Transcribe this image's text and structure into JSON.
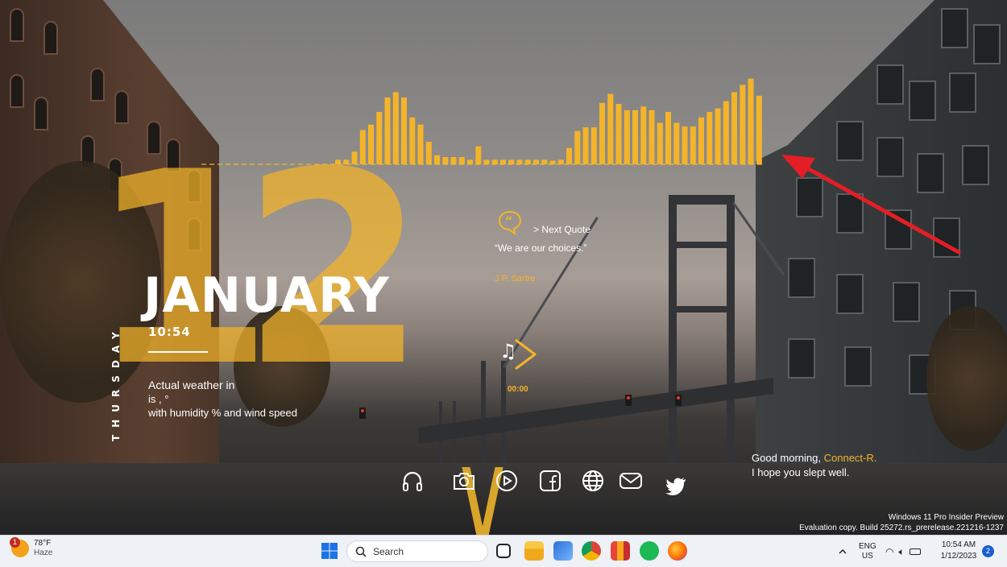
{
  "rainmeter": {
    "day_number": "12",
    "month": "JANUARY",
    "time": "10:54",
    "weekday": "THURSDAY",
    "weather_line1": "Actual weather in",
    "weather_line2": "is , °",
    "weather_line3": "with humidity  % and wind speed",
    "quote_next": "> Next Quote",
    "quote_text": "“We are our choices.”",
    "quote_author": "J.P. Sartre",
    "music_time": "00:00",
    "greeting_prefix": "Good morning, ",
    "greeting_name": "Connect-R.",
    "greeting_sub": "I hope you slept well.",
    "accent_color": "#f4b42a",
    "visualizer_levels": [
      0.05,
      0.05,
      0.14,
      0.38,
      0.44,
      0.58,
      0.74,
      0.8,
      0.74,
      0.52,
      0.44,
      0.25,
      0.1,
      0.08,
      0.08,
      0.08,
      0.05,
      0.2,
      0.05,
      0.05,
      0.05,
      0.05,
      0.05,
      0.05,
      0.05,
      0.05,
      0.04,
      0.05,
      0.18,
      0.37,
      0.41,
      0.41,
      0.68,
      0.78,
      0.67,
      0.6,
      0.6,
      0.64,
      0.6,
      0.46,
      0.58,
      0.46,
      0.42,
      0.42,
      0.52,
      0.58,
      0.62,
      0.7,
      0.8,
      0.88,
      0.95,
      0.76
    ],
    "launchers": [
      "headphones-icon",
      "camera-icon",
      "play-icon",
      "facebook-icon",
      "globe-icon",
      "mail-icon",
      "twitter-icon"
    ]
  },
  "watermark": {
    "line1": "Windows 11 Pro Insider Preview",
    "line2": "Evaluation copy. Build 25272.rs_prerelease.221216-1237"
  },
  "taskbar": {
    "weather_temp": "78°F",
    "weather_desc": "Haze",
    "weather_badge": "1",
    "search_label": "Search",
    "apps": [
      "task-view-icon",
      "file-explorer-icon",
      "remote-desktop-icon",
      "chrome-icon",
      "office-icon",
      "spotify-icon",
      "firefox-icon"
    ],
    "lang": "ENG",
    "region": "US",
    "time": "10:54 AM",
    "date": "1/12/2023",
    "notification_count": "2"
  }
}
